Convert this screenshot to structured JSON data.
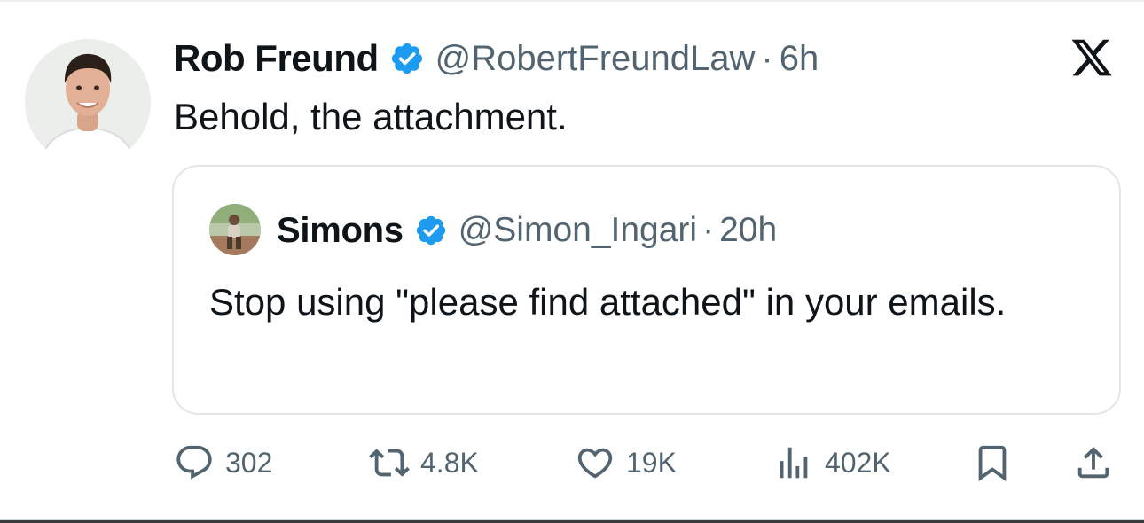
{
  "tweet": {
    "author": {
      "name": "Rob Freund",
      "handle": "@RobertFreundLaw",
      "time": "6h",
      "verified": true
    },
    "text": "Behold, the attachment.",
    "quoted": {
      "name": "Simons",
      "handle": "@Simon_Ingari",
      "time": "20h",
      "verified": true,
      "text": "Stop using \"please find attached\" in your emails."
    },
    "stats": {
      "replies": "302",
      "retweets": "4.8K",
      "likes": "19K",
      "views": "402K"
    },
    "separator": "·"
  },
  "icons": {
    "verified": "verified-badge-icon",
    "platform": "x-logo-icon",
    "reply": "reply-icon",
    "retweet": "retweet-icon",
    "like": "heart-icon",
    "views": "views-chart-icon",
    "bookmark": "bookmark-icon",
    "share": "share-icon"
  },
  "colors": {
    "text": "#0f1419",
    "secondary": "#536471",
    "verified": "#1d9bf0",
    "border": "#e3e6e8"
  }
}
